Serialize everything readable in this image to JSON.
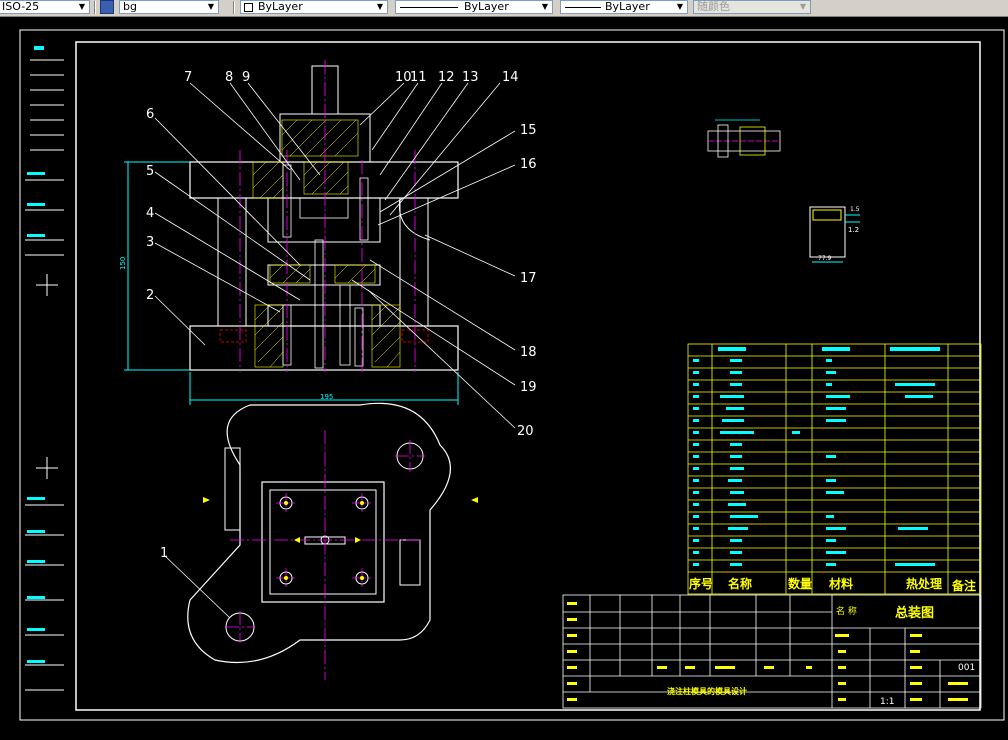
{
  "toolbar": {
    "dimstyle_value": "ISO-25",
    "layer_value": "bg",
    "color_value": "ByLayer",
    "linetype_value": "ByLayer",
    "lineweight_value": "ByLayer",
    "plotstyle_value": "随颜色"
  },
  "part_numbers": [
    "1",
    "2",
    "3",
    "4",
    "5",
    "6",
    "7",
    "8",
    "9",
    "10",
    "11",
    "12",
    "13",
    "14",
    "15",
    "16",
    "17",
    "18",
    "19",
    "20"
  ],
  "dimensions": {
    "height": "150",
    "width": "195",
    "detail_a": "1.2",
    "detail_b": "77.9",
    "detail_c": "1.5"
  },
  "bom_headers": {
    "seq": "序号",
    "name": "名称",
    "qty": "数量",
    "material": "材料",
    "treatment": "热处理",
    "remark": "备注"
  },
  "title_block": {
    "drawing_title": "总装图",
    "name_label": "名 称",
    "design_title": "浇注柱模具的模具设计",
    "drawing_no": "001",
    "scale": "1:1"
  },
  "colors": {
    "background": "#000000",
    "frame": "#ffffff",
    "centerline": "#ff00ff",
    "dimension": "#00ffff",
    "table_grid": "#ffff00",
    "hatch": "#ffff00",
    "hidden": "#ff0000",
    "table_text_cyan": "#00ffff",
    "table_text_yellow": "#ffff00"
  }
}
